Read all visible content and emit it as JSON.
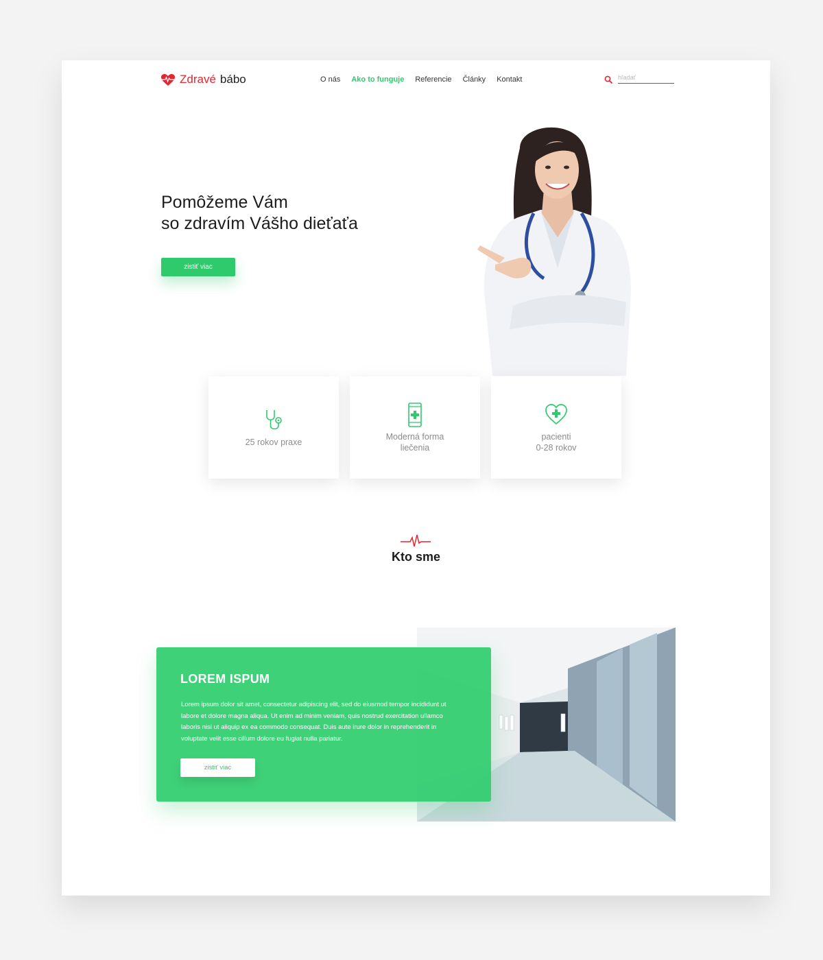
{
  "header": {
    "brand_part1": "Zdravé",
    "brand_part2": "bábo",
    "nav": [
      {
        "label": "O nás"
      },
      {
        "label": "Ako to funguje"
      },
      {
        "label": "Referencie"
      },
      {
        "label": "Články"
      },
      {
        "label": "Kontakt"
      }
    ],
    "search_placeholder": "hľadať"
  },
  "hero": {
    "title_line1": "Pomôžeme Vám",
    "title_line2": "so zdravím Vášho dieťaťa",
    "cta_label": "zistiť viac"
  },
  "features": [
    {
      "icon": "stethoscope-icon",
      "line1": "25 rokov praxe",
      "line2": ""
    },
    {
      "icon": "mobile-plus-icon",
      "line1": "Moderná forma",
      "line2": "liečenia"
    },
    {
      "icon": "heart-plus-icon",
      "line1": "pacienti",
      "line2": "0-28 rokov"
    }
  ],
  "about": {
    "section_title": "Kto sme",
    "card_title": "LOREM ISPUM",
    "card_text": "Lorem ipsum dolor sit amet, consectetur adipiscing elit, sed do eiusmod tempor incididunt ut labore et dolore magna aliqua. Ut enim ad minim veniam, quis nostrud exercitation ullamco laboris nisi ut aliquip ex ea commodo consequat. Duis aute irure dolor in reprehenderit in voluptate velit esse cillum dolore eu fugiat nulla pariatur.",
    "card_cta": "zistiť viac"
  },
  "colors": {
    "brand_red": "#e3262f",
    "accent_green": "#2fca6c",
    "background": "#f3f3f3"
  }
}
